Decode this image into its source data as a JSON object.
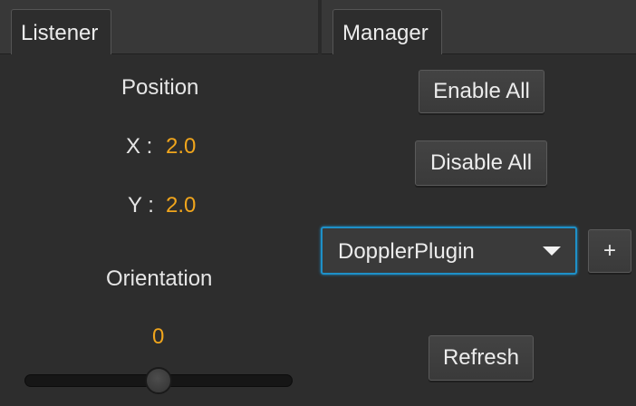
{
  "tabs": {
    "listener": "Listener",
    "manager": "Manager"
  },
  "listener": {
    "position_label": "Position",
    "x_label": "X :",
    "x_value": "2.0",
    "y_label": "Y :",
    "y_value": "2.0",
    "orientation_label": "Orientation",
    "orientation_value": "0",
    "orientation_slider_fraction": 0.5
  },
  "manager": {
    "enable_all_label": "Enable All",
    "disable_all_label": "Disable All",
    "plugin_selected": "DopplerPlugin",
    "add_label": "+",
    "refresh_label": "Refresh"
  },
  "colors": {
    "accent_value": "#f0a51c",
    "focus_border": "#1e90c8",
    "background": "#2d2d2d"
  },
  "icons": {
    "dropdown": "chevron-down-icon"
  }
}
